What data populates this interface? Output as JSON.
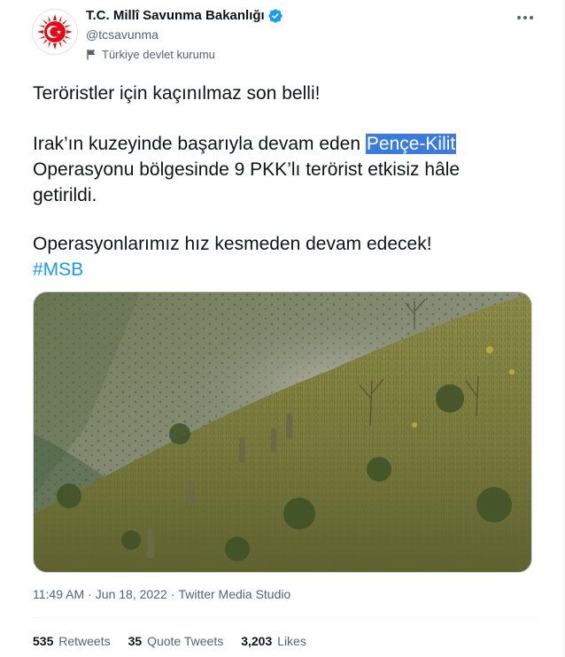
{
  "account": {
    "display_name": "T.C. Millî Savunma Bakanlığı",
    "handle": "@tcsavunma",
    "affiliation": "Türkiye devlet kurumu",
    "verified": true,
    "avatar_icon": "ministry-emblem-icon"
  },
  "tweet": {
    "line1": "Teröristler için kaçınılmaz son belli!",
    "para2_prefix": "Irak’ın kuzeyinde başarıyla devam eden ",
    "para2_highlight": "Pençe-Kilit",
    "para2_line2": "Operasyonu bölgesinde 9 PKK’lı terörist etkisiz hâle",
    "para2_line3": "getirildi.",
    "line4": "Operasyonlarımız hız kesmeden devam edecek!",
    "hashtag": "#MSB"
  },
  "meta": {
    "time": "11:49 AM",
    "separator": "·",
    "date": "Jun 18, 2022",
    "source": "Twitter Media Studio"
  },
  "stats": {
    "retweets_count": "535",
    "retweets_label": "Retweets",
    "quotes_count": "35",
    "quotes_label": "Quote Tweets",
    "likes_count": "3,203",
    "likes_label": "Likes"
  },
  "colors": {
    "accent": "#1d9bf0",
    "highlight": "#3b7be0",
    "emblem_red": "#e30a17"
  }
}
